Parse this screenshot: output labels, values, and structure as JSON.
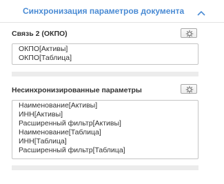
{
  "header": {
    "title": "Синхронизация параметров документа",
    "collapse_icon": "chevron-up-icon",
    "accent_color": "#4a8bd4"
  },
  "sections": [
    {
      "label": "Связь 2 (ОКПО)",
      "settings_icon": "gear-icon",
      "items": [
        "ОКПО[Активы]",
        "ОКПО[Таблица]"
      ]
    },
    {
      "label": "Несинхронизированные параметры",
      "settings_icon": "gear-icon",
      "items": [
        "Наименование[Активы]",
        "ИНН[Активы]",
        "Расширенный фильтр[Активы]",
        "Наименование[Таблица]",
        "ИНН[Таблица]",
        "Расширенный фильтр[Таблица]"
      ]
    }
  ]
}
